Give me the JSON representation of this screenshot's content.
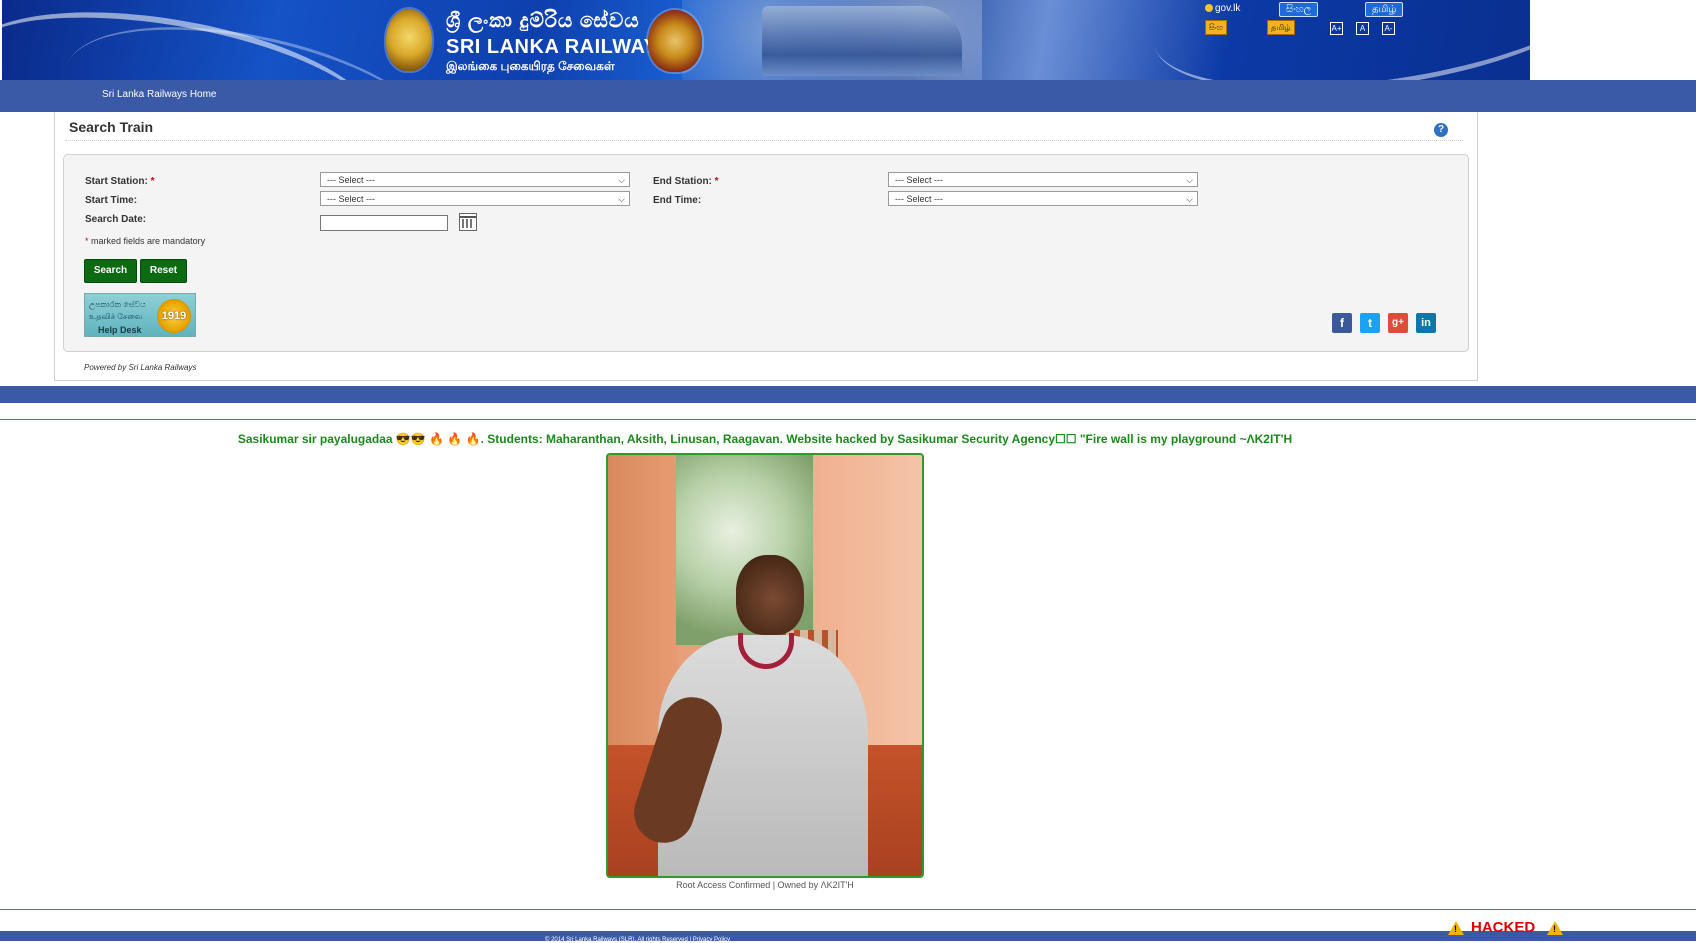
{
  "banner": {
    "sinhala_title": "ශ්‍රී ලංකා දුම්රිය සේවය",
    "title": "SRI LANKA RAILWAYS",
    "tamil_title": "இலங்கை புகையிரத சேவைகள்",
    "gov_link": "gov.lk",
    "lang_sinhala": "සිංහල",
    "lang_tamil": "தமிழ்",
    "flag_left": "සිංහ",
    "flag_right": "தமிழ்",
    "font_sizes": [
      "A+",
      "A",
      "A-"
    ]
  },
  "nav": {
    "home": "Sri Lanka Railways Home"
  },
  "search": {
    "title": "Search Train",
    "help": "?",
    "start_station_label": "Start Station:",
    "end_station_label": "End Station:",
    "start_time_label": "Start Time:",
    "end_time_label": "End Time:",
    "search_date_label": "Search Date:",
    "required_mark": "*",
    "select_placeholder": "--- Select ---",
    "mandatory_note": "marked fields are mandatory",
    "search_button": "Search",
    "reset_button": "Reset",
    "helpdesk_line1": "උපකාරක සේවය",
    "helpdesk_line2": "உதவிச் சேவை",
    "helpdesk_label": "Help Desk",
    "helpdesk_number": "1919",
    "social": [
      "f",
      "t",
      "g+",
      "in"
    ],
    "powered_by": "Powered by Sri Lanka Railways"
  },
  "hack": {
    "message": "Sasikumar sir payalugadaa 😎😎 🔥 🔥 🔥. Students: Maharanthan, Aksith, Linusan, Raagavan. Website hacked by Sasikumar Security Agency☐☐ \"Fire wall is my playground ~ΛK2IT'H",
    "caption": "Root Access Confirmed | Owned by ΛK2IT'H",
    "hacked_label": "HACKED",
    "warn_mark": "!"
  },
  "footer": {
    "text": "© 2014 Sri Lanka Railways (SLR). All rights Reserved | Privacy Policy"
  },
  "colors": {
    "nav_blue": "#3a5aa8",
    "button_green": "#0b6a12",
    "hack_green": "#1a8a1a",
    "hacked_red": "#e00000"
  }
}
